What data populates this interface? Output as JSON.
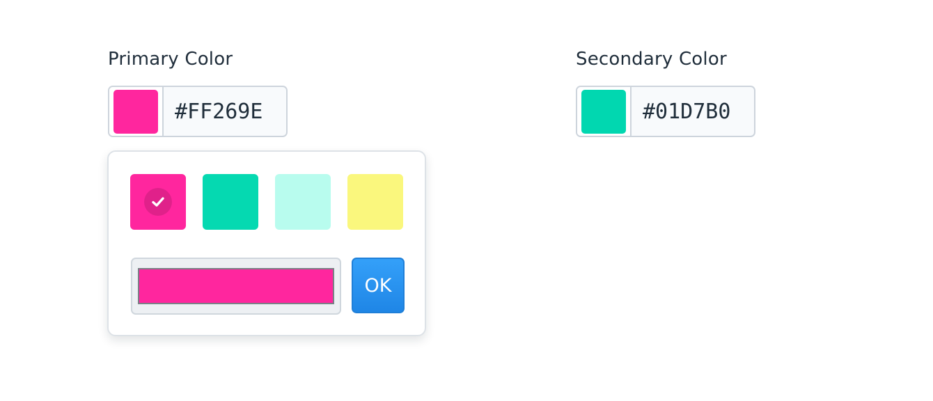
{
  "primary": {
    "label": "Primary Color",
    "hex": "#FF269E",
    "swatch_color": "#FF269E"
  },
  "secondary": {
    "label": "Secondary Color",
    "hex": "#01D7B0",
    "swatch_color": "#01D7B0"
  },
  "picker": {
    "presets": [
      {
        "color": "#FF269E",
        "selected": true
      },
      {
        "color": "#05D9B1",
        "selected": false
      },
      {
        "color": "#B8FCEE",
        "selected": false
      },
      {
        "color": "#FAF77D",
        "selected": false
      }
    ],
    "native_input_color": "#FF269E",
    "ok_label": "OK",
    "accent": "#2592EE",
    "check_icon": "check-icon"
  }
}
